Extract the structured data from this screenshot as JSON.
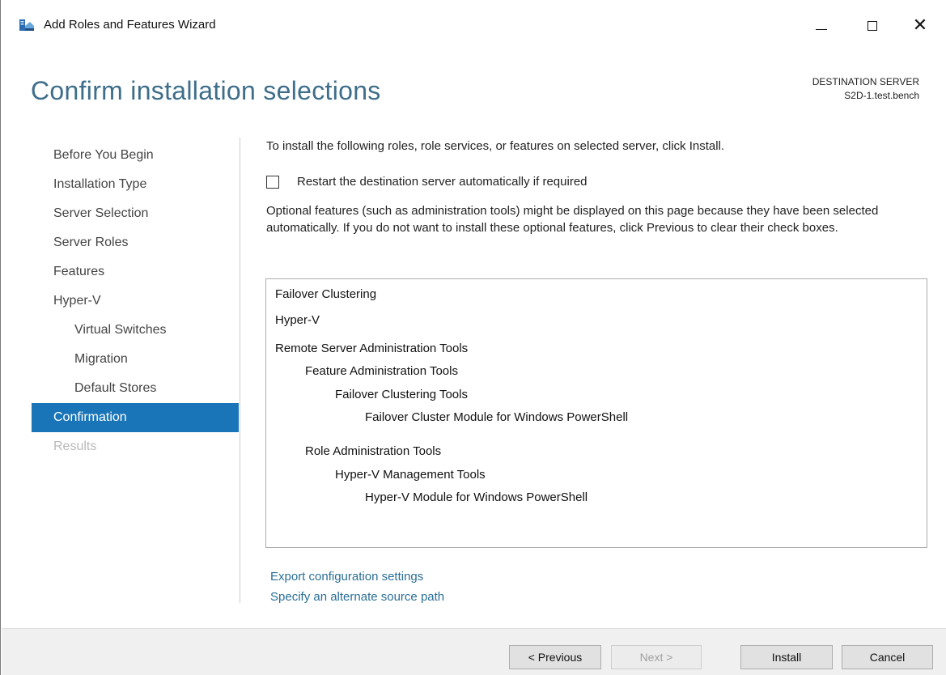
{
  "window": {
    "title": "Add Roles and Features Wizard"
  },
  "header": {
    "title": "Confirm installation selections",
    "destination_label": "DESTINATION SERVER",
    "destination_value": "S2D-1.test.bench"
  },
  "nav": {
    "items": [
      {
        "label": "Before You Begin",
        "state": "normal"
      },
      {
        "label": "Installation Type",
        "state": "normal"
      },
      {
        "label": "Server Selection",
        "state": "normal"
      },
      {
        "label": "Server Roles",
        "state": "normal"
      },
      {
        "label": "Features",
        "state": "normal"
      },
      {
        "label": "Hyper-V",
        "state": "normal"
      },
      {
        "label": "Virtual Switches",
        "state": "sub"
      },
      {
        "label": "Migration",
        "state": "sub"
      },
      {
        "label": "Default Stores",
        "state": "sub"
      },
      {
        "label": "Confirmation",
        "state": "active"
      },
      {
        "label": "Results",
        "state": "disabled"
      }
    ]
  },
  "content": {
    "intro": "To install the following roles, role services, or features on selected server, click Install.",
    "restart_checkbox": {
      "label": "Restart the destination server automatically if required",
      "checked": false
    },
    "note": "Optional features (such as administration tools) might be displayed on this page because they have been selected automatically. If you do not want to install these optional features, click Previous to clear their check boxes.",
    "selections": [
      {
        "label": "Failover Clustering",
        "level": 0
      },
      {
        "label": "Hyper-V",
        "level": 0
      },
      {
        "label": "Remote Server Administration Tools",
        "level": 0
      },
      {
        "label": "Feature Administration Tools",
        "level": 1
      },
      {
        "label": "Failover Clustering Tools",
        "level": 2
      },
      {
        "label": "Failover Cluster Module for Windows PowerShell",
        "level": 3
      },
      {
        "label": "Role Administration Tools",
        "level": 1
      },
      {
        "label": "Hyper-V Management Tools",
        "level": 2
      },
      {
        "label": "Hyper-V Module for Windows PowerShell",
        "level": 3
      }
    ],
    "links": {
      "export": "Export configuration settings",
      "alternate_source": "Specify an alternate source path"
    }
  },
  "footer": {
    "previous": "< Previous",
    "next": "Next >",
    "install": "Install",
    "cancel": "Cancel"
  },
  "colors": {
    "accent": "#1a75b8",
    "title": "#3e6e8a",
    "link": "#2a6e96"
  }
}
